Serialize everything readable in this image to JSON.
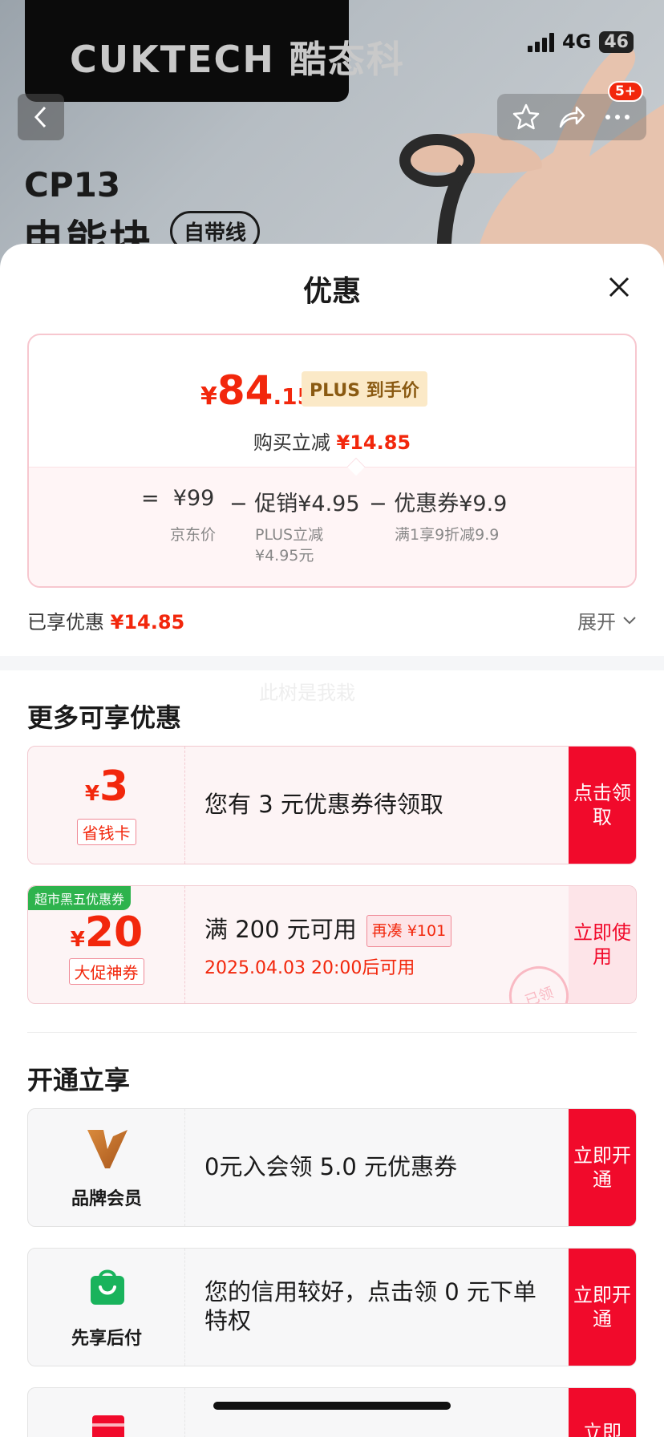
{
  "status_bar": {
    "network": "4G",
    "battery": "46"
  },
  "product_banner": {
    "brand": "CUKTECH 酷态科",
    "model": "CP13",
    "name": "电能块",
    "tag": "自带线",
    "cart_badge": "5+"
  },
  "sheet": {
    "title": "优惠",
    "price": {
      "symbol": "¥",
      "integer": "84",
      "decimal": ".15",
      "tag": "PLUS 到手价"
    },
    "discount_line": {
      "label": "购买立减",
      "value": "¥14.85"
    },
    "breakdown": [
      {
        "op": "=",
        "value": "¥99",
        "sub": "京东价"
      },
      {
        "op": "−",
        "value": "促销¥4.95",
        "sub": "PLUS立减¥4.95元"
      },
      {
        "op": "−",
        "value": "优惠券¥9.9",
        "sub": "满1享9折减9.9"
      }
    ],
    "enjoyed": {
      "label": "已享优惠",
      "value": "¥14.85"
    },
    "expand_label": "展开",
    "watermark": "此树是我栽"
  },
  "more_offers": {
    "title": "更多可享优惠",
    "coupons": [
      {
        "symbol": "¥",
        "amount": "3",
        "tag": "省钱卡",
        "desc": "您有 3 元优惠券待领取",
        "button": "点击领取"
      },
      {
        "ribbon": "超市黑五优惠券",
        "symbol": "¥",
        "amount": "20",
        "tag": "大促神券",
        "desc": "满 200 元可用",
        "pill": "再凑 ¥101",
        "sub": "2025.04.03 20:00后可用",
        "button": "立即使用",
        "stamp": "已领"
      }
    ]
  },
  "open_enjoy": {
    "title": "开通立享",
    "services": [
      {
        "icon": "brand-member-v-icon",
        "name": "品牌会员",
        "desc": "0元入会领 5.0 元优惠券",
        "button": "立即开通"
      },
      {
        "icon": "shopping-bag-icon",
        "name": "先享后付",
        "desc": "您的信用较好，点击领 0 元下单特权",
        "button": "立即开通"
      },
      {
        "icon": "card-icon",
        "name": "",
        "desc": "",
        "button": "立即"
      }
    ]
  },
  "colors": {
    "accent": "#f2270c",
    "button_red": "#f10a2b",
    "plus_gold": "#fbe9c7",
    "green": "#2eb34d"
  }
}
